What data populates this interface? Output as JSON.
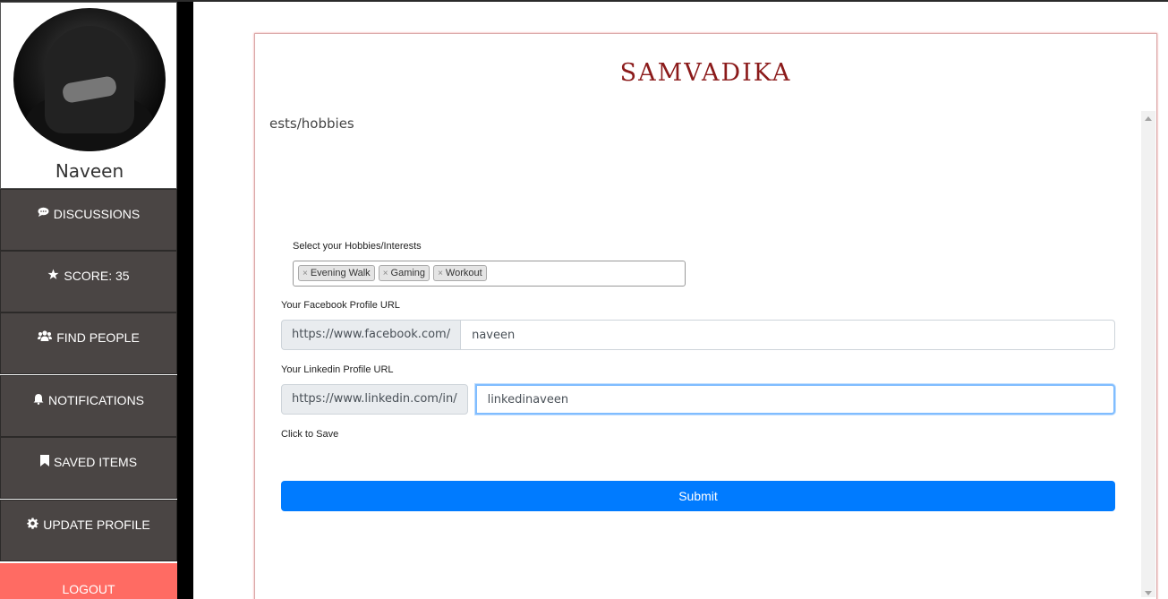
{
  "profile": {
    "name": "Naveen"
  },
  "sidebar": {
    "items": [
      {
        "label": "DISCUSSIONS",
        "icon": "comment-icon"
      },
      {
        "label": "SCORE: 35",
        "icon": "star-icon"
      },
      {
        "label": "FIND PEOPLE",
        "icon": "users-icon"
      },
      {
        "label": "NOTIFICATIONS",
        "icon": "bell-icon"
      },
      {
        "label": "SAVED ITEMS",
        "icon": "bookmark-icon"
      },
      {
        "label": "UPDATE PROFILE",
        "icon": "gear-icon"
      }
    ],
    "logout": "LOGOUT"
  },
  "brand": "SAMVADIKA",
  "form": {
    "section_title": "ests/hobbies",
    "hobbies_label": "Select your Hobbies/Interests",
    "tags": [
      "Evening Walk",
      "Gaming",
      "Workout"
    ],
    "facebook": {
      "label": "Your Facebook Profile URL",
      "prefix": "https://www.facebook.com/",
      "value": "naveen"
    },
    "linkedin": {
      "label": "Your Linkedin Profile URL",
      "prefix": "https://www.linkedin.com/in/",
      "value": "linkedinaveen"
    },
    "save_label": "Click to Save",
    "submit_label": "Submit"
  },
  "colors": {
    "sidebar_bg": "#4a4544",
    "logout_bg": "#ff6b63",
    "brand": "#8b1a1a",
    "submit_bg": "#007bff"
  }
}
